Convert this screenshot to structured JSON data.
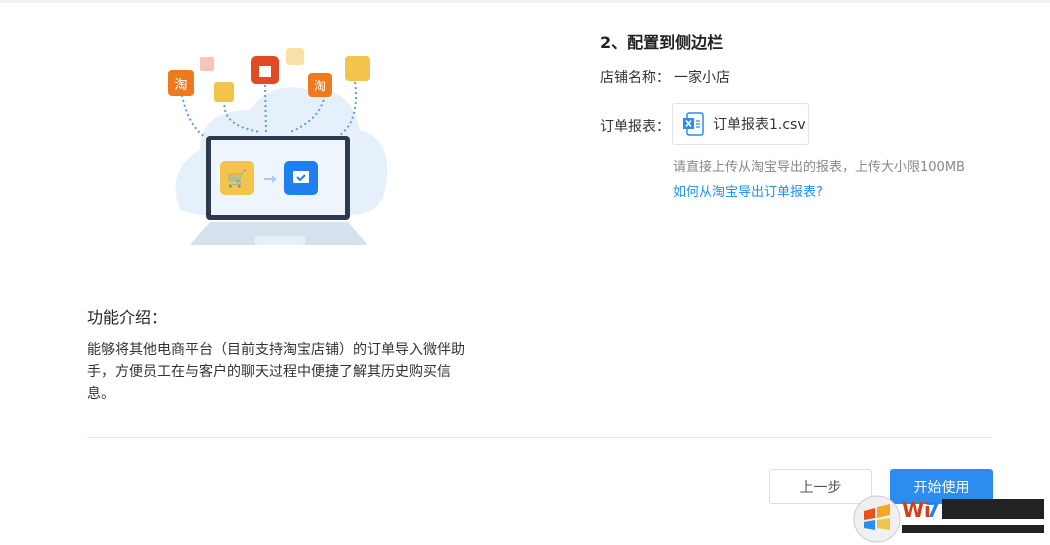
{
  "intro": {
    "title": "功能介绍：",
    "text": "能够将其他电商平台（目前支持淘宝店铺）的订单导入微伴助手，方便员工在与客户的聊天过程中便捷了解其历史购买信息。"
  },
  "config": {
    "step_title": "2、配置到侧边栏",
    "shop_label": "店铺名称：",
    "shop_value": "一家小店",
    "report_label": "订单报表：",
    "file_name": "订单报表1.csv",
    "file_icon": "excel-file-icon",
    "hint": "请直接上传从淘宝导出的报表，上传大小限100MB",
    "help_link": "如何从淘宝导出订单报表?"
  },
  "illustration": {
    "taobao_glyph": "淘"
  },
  "footer": {
    "prev_label": "上一步",
    "start_label": "开始使用"
  },
  "watermark": {
    "text": "Win7系统之家"
  },
  "colors": {
    "accent": "#2d8cf0",
    "link": "#1890ff"
  }
}
